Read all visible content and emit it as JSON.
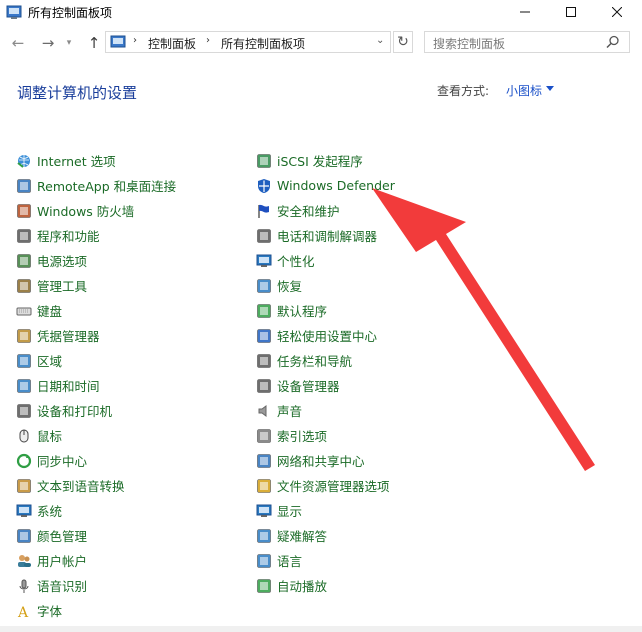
{
  "window": {
    "title": "所有控制面板项"
  },
  "address_bar": {
    "crumbs": [
      "控制面板",
      "所有控制面板项"
    ]
  },
  "search": {
    "placeholder": "搜索控制面板"
  },
  "main": {
    "title": "调整计算机的设置",
    "view_by_label": "查看方式:",
    "view_by_value": "小图标"
  },
  "items_left": [
    {
      "label": "Internet 选项",
      "icon": "globe-icon",
      "color": "#2b8a3e"
    },
    {
      "label": "RemoteApp 和桌面连接",
      "icon": "remote-desktop-icon",
      "color": "#2a6fb9"
    },
    {
      "label": "Windows 防火墙",
      "icon": "firewall-icon",
      "color": "#b34a1e"
    },
    {
      "label": "程序和功能",
      "icon": "programs-icon",
      "color": "#555555"
    },
    {
      "label": "电源选项",
      "icon": "power-icon",
      "color": "#3a7d3a"
    },
    {
      "label": "管理工具",
      "icon": "admin-tools-icon",
      "color": "#8a6a2a"
    },
    {
      "label": "键盘",
      "icon": "keyboard-icon",
      "color": "#666666"
    },
    {
      "label": "凭据管理器",
      "icon": "credential-icon",
      "color": "#b88a2a"
    },
    {
      "label": "区域",
      "icon": "region-icon",
      "color": "#2a7ac0"
    },
    {
      "label": "日期和时间",
      "icon": "clock-icon",
      "color": "#2a7ac0"
    },
    {
      "label": "设备和打印机",
      "icon": "printer-icon",
      "color": "#555555"
    },
    {
      "label": "鼠标",
      "icon": "mouse-icon",
      "color": "#555555"
    },
    {
      "label": "同步中心",
      "icon": "sync-icon",
      "color": "#2f9e44"
    },
    {
      "label": "文本到语音转换",
      "icon": "speech-icon",
      "color": "#c08a2a"
    },
    {
      "label": "系统",
      "icon": "system-icon",
      "color": "#2a7ac0"
    },
    {
      "label": "颜色管理",
      "icon": "color-icon",
      "color": "#2a6fb9"
    },
    {
      "label": "用户帐户",
      "icon": "users-icon",
      "color": "#3a7d9a"
    },
    {
      "label": "语音识别",
      "icon": "microphone-icon",
      "color": "#555555"
    },
    {
      "label": "字体",
      "icon": "font-icon",
      "color": "#d4a017"
    }
  ],
  "items_right": [
    {
      "label": "iSCSI 发起程序",
      "icon": "iscsi-icon",
      "color": "#2a8a4a"
    },
    {
      "label": "Windows Defender",
      "icon": "defender-icon",
      "color": "#1f5fbf"
    },
    {
      "label": "安全和维护",
      "icon": "flag-icon",
      "color": "#1f4fbf"
    },
    {
      "label": "电话和调制解调器",
      "icon": "phone-icon",
      "color": "#555555"
    },
    {
      "label": "个性化",
      "icon": "personalize-icon",
      "color": "#2a7ac0"
    },
    {
      "label": "恢复",
      "icon": "recovery-icon",
      "color": "#2a7ac0"
    },
    {
      "label": "默认程序",
      "icon": "default-programs-icon",
      "color": "#2f9e44"
    },
    {
      "label": "轻松使用设置中心",
      "icon": "ease-of-access-icon",
      "color": "#1f5fbf"
    },
    {
      "label": "任务栏和导航",
      "icon": "taskbar-icon",
      "color": "#555555"
    },
    {
      "label": "设备管理器",
      "icon": "device-manager-icon",
      "color": "#555555"
    },
    {
      "label": "声音",
      "icon": "speaker-icon",
      "color": "#777777"
    },
    {
      "label": "索引选项",
      "icon": "index-icon",
      "color": "#777777"
    },
    {
      "label": "网络和共享中心",
      "icon": "network-icon",
      "color": "#2a6fb9"
    },
    {
      "label": "文件资源管理器选项",
      "icon": "folder-options-icon",
      "color": "#d4a017"
    },
    {
      "label": "显示",
      "icon": "display-icon",
      "color": "#2a7ac0"
    },
    {
      "label": "疑难解答",
      "icon": "troubleshoot-icon",
      "color": "#2a7ac0"
    },
    {
      "label": "语言",
      "icon": "language-icon",
      "color": "#2a7ac0"
    },
    {
      "label": "自动播放",
      "icon": "autoplay-icon",
      "color": "#2f9e44"
    }
  ],
  "colors": {
    "link_green": "#1b6b27",
    "title_blue": "#1a3e9b",
    "annotation_red": "#f23b3b"
  }
}
